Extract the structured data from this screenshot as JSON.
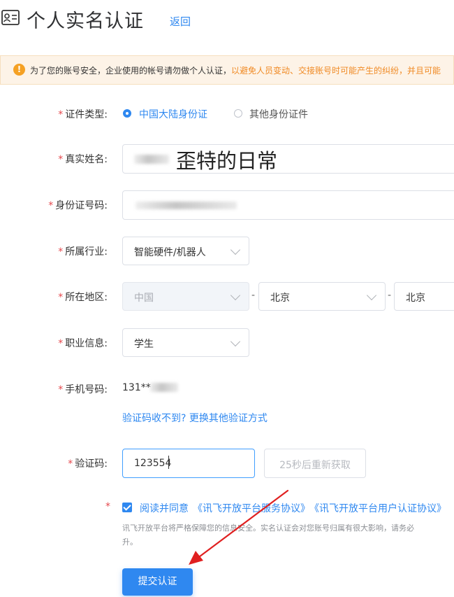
{
  "header": {
    "title": "个人实名认证",
    "back_label": "返回"
  },
  "notice": {
    "text": "为了您的账号安全，企业使用的帐号请勿做个人认证，",
    "warn_text": "以避免人员变动、交接账号时可能产生的纠纷，并且可能"
  },
  "colors": {
    "accent": "#2f88f0",
    "required": "#e5484d",
    "warn": "#f08a24"
  },
  "form": {
    "id_type": {
      "label": "证件类型:",
      "options": [
        {
          "label": "中国大陆身份证",
          "selected": true
        },
        {
          "label": "其他身份证件",
          "selected": false
        }
      ]
    },
    "real_name": {
      "label": "真实姓名:",
      "overlay_text": "歪特的日常"
    },
    "id_number": {
      "label": "身份证号码:"
    },
    "industry": {
      "label": "所属行业:",
      "value": "智能硬件/机器人"
    },
    "region": {
      "label": "所在地区:",
      "country": "中国",
      "province": "北京",
      "city": "北京",
      "separator": "-"
    },
    "occupation": {
      "label": "职业信息:",
      "value": "学生"
    },
    "phone": {
      "label": "手机号码:",
      "value": "131**",
      "alt_link": "验证码收不到? 更换其他验证方式"
    },
    "code": {
      "label": "验证码:",
      "value": "123554",
      "resend_label": "25秒后重新获取"
    },
    "agreement": {
      "text": "阅读并同意",
      "link1": "《讯飞开放平台服务协议》",
      "link2": "《讯飞开放平台用户认证协议》",
      "note_line1": "讯飞开放平台将严格保障您的信息安全。实名认证会对您账号归属有很大影响，请务必",
      "note_line2": "升。"
    },
    "submit_label": "提交认证"
  }
}
